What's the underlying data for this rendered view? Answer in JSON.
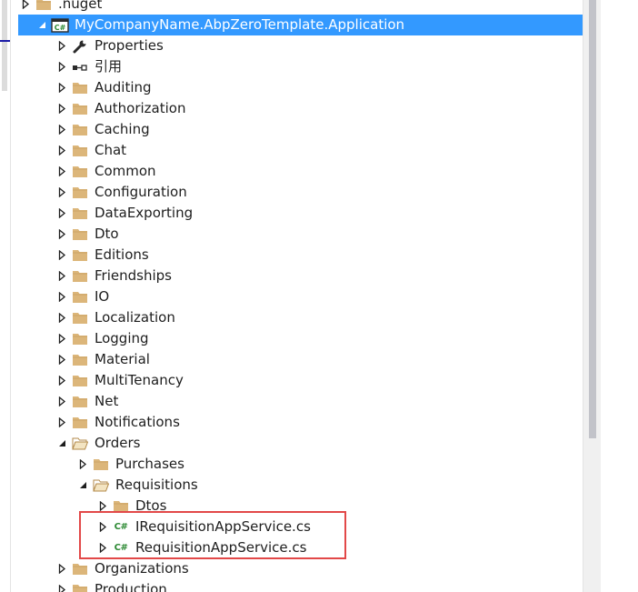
{
  "colors": {
    "selection": "#3399ff",
    "folder": "#dcb67a",
    "csharp": "#2d8a34",
    "highlight_border": "#e24848"
  },
  "tree": {
    "rows": [
      {
        "label": ".nuget",
        "icon": "folder-icon",
        "toggle": "collapsed"
      },
      {
        "label": "MyCompanyName.AbpZeroTemplate.Application",
        "icon": "csharp-project-icon",
        "toggle": "expanded",
        "selected": true
      },
      {
        "label": "Properties",
        "icon": "wrench-icon",
        "toggle": "collapsed"
      },
      {
        "label": "引用",
        "icon": "references-icon",
        "toggle": "collapsed"
      },
      {
        "label": "Auditing",
        "icon": "folder-icon",
        "toggle": "collapsed"
      },
      {
        "label": "Authorization",
        "icon": "folder-icon",
        "toggle": "collapsed"
      },
      {
        "label": "Caching",
        "icon": "folder-icon",
        "toggle": "collapsed"
      },
      {
        "label": "Chat",
        "icon": "folder-icon",
        "toggle": "collapsed"
      },
      {
        "label": "Common",
        "icon": "folder-icon",
        "toggle": "collapsed"
      },
      {
        "label": "Configuration",
        "icon": "folder-icon",
        "toggle": "collapsed"
      },
      {
        "label": "DataExporting",
        "icon": "folder-icon",
        "toggle": "collapsed"
      },
      {
        "label": "Dto",
        "icon": "folder-icon",
        "toggle": "collapsed"
      },
      {
        "label": "Editions",
        "icon": "folder-icon",
        "toggle": "collapsed"
      },
      {
        "label": "Friendships",
        "icon": "folder-icon",
        "toggle": "collapsed"
      },
      {
        "label": "IO",
        "icon": "folder-icon",
        "toggle": "collapsed"
      },
      {
        "label": "Localization",
        "icon": "folder-icon",
        "toggle": "collapsed"
      },
      {
        "label": "Logging",
        "icon": "folder-icon",
        "toggle": "collapsed"
      },
      {
        "label": "Material",
        "icon": "folder-icon",
        "toggle": "collapsed"
      },
      {
        "label": "MultiTenancy",
        "icon": "folder-icon",
        "toggle": "collapsed"
      },
      {
        "label": "Net",
        "icon": "folder-icon",
        "toggle": "collapsed"
      },
      {
        "label": "Notifications",
        "icon": "folder-icon",
        "toggle": "collapsed"
      },
      {
        "label": "Orders",
        "icon": "folder-open-icon",
        "toggle": "expanded"
      },
      {
        "label": "Purchases",
        "icon": "folder-icon",
        "toggle": "collapsed"
      },
      {
        "label": "Requisitions",
        "icon": "folder-open-icon",
        "toggle": "expanded"
      },
      {
        "label": "Dtos",
        "icon": "folder-icon",
        "toggle": "collapsed"
      },
      {
        "label": "IRequisitionAppService.cs",
        "icon": "csharp-file-icon",
        "toggle": "collapsed"
      },
      {
        "label": "RequisitionAppService.cs",
        "icon": "csharp-file-icon",
        "toggle": "collapsed"
      },
      {
        "label": "Organizations",
        "icon": "folder-icon",
        "toggle": "collapsed"
      },
      {
        "label": "Production",
        "icon": "folder-icon",
        "toggle": "collapsed"
      }
    ]
  }
}
